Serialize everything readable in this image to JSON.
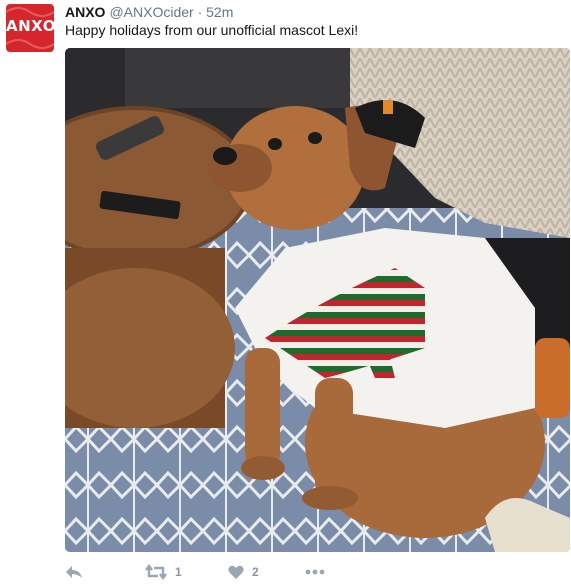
{
  "tweet": {
    "avatar_text": "ANXO",
    "display_name": "ANXO",
    "handle": "@ANXOcider",
    "separator": "·",
    "time": "52m",
    "text": "Happy holidays from our unofficial mascot Lexi!",
    "media_icon": "photo",
    "actions": {
      "reply_icon": "reply-icon",
      "retweet_icon": "retweet-icon",
      "retweet_count": "1",
      "like_icon": "heart-icon",
      "like_count": "2",
      "more_icon": "more-icon"
    },
    "colors": {
      "avatar": "#d7262b",
      "text": "#14171a",
      "muted": "#657786",
      "action": "#9aa6b2"
    }
  }
}
